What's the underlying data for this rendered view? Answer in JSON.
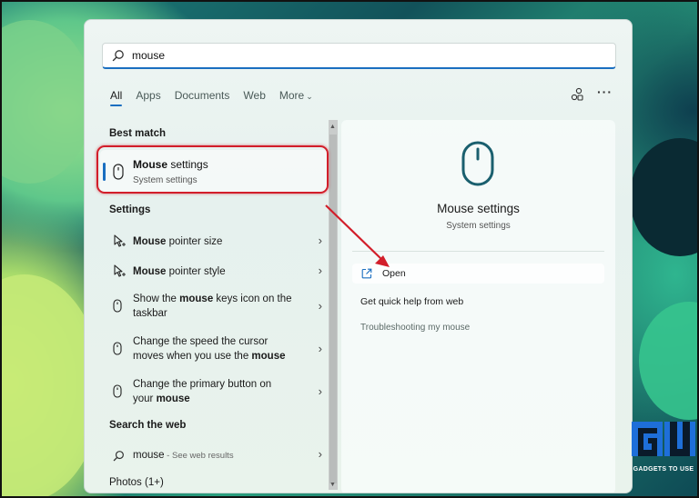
{
  "search": {
    "value": "mouse"
  },
  "tabs": [
    "All",
    "Apps",
    "Documents",
    "Web",
    "More"
  ],
  "sections": {
    "best_match": "Best match",
    "settings": "Settings",
    "search_web": "Search the web",
    "photos": "Photos (1+)"
  },
  "best_match": {
    "title_bold": "Mouse",
    "title_rest": " settings",
    "subtitle": "System settings"
  },
  "settings_items": [
    {
      "bold": "Mouse",
      "rest": " pointer size",
      "icon": "pointer-icon"
    },
    {
      "bold": "Mouse",
      "rest": " pointer style",
      "icon": "pointer-icon"
    },
    {
      "pre": "Show the ",
      "bold": "mouse",
      "rest": " keys icon on the taskbar",
      "icon": "mouse-icon"
    },
    {
      "pre": "Change the speed the cursor moves when you use the ",
      "bold": "mouse",
      "rest": "",
      "icon": "mouse-icon"
    },
    {
      "pre": "Change the primary button on your ",
      "bold": "mouse",
      "rest": "",
      "icon": "mouse-icon"
    }
  ],
  "web_result": {
    "query": "mouse",
    "sep": " - ",
    "suffix": "See web results"
  },
  "detail": {
    "title": "Mouse settings",
    "subtitle": "System settings",
    "open_label": "Open",
    "help_label": "Get quick help from web",
    "trouble_label": "Troubleshooting my mouse"
  },
  "watermark": {
    "text": "GADGETS TO USE"
  },
  "colors": {
    "accent": "#1a6ec0",
    "highlight": "#d21e2a",
    "icon": "#1a5f6e"
  }
}
